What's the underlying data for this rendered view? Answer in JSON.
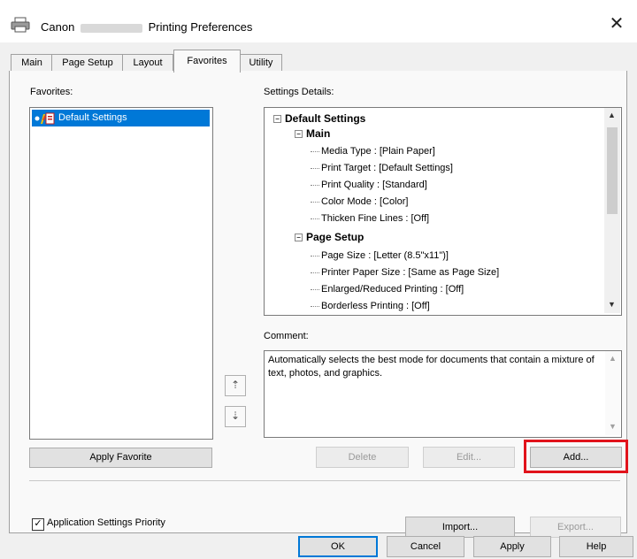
{
  "window": {
    "title_prefix": "Canon",
    "title_suffix": "Printing Preferences",
    "close_glyph": "✕"
  },
  "tabs": [
    {
      "label": "Main"
    },
    {
      "label": "Page Setup"
    },
    {
      "label": "Layout"
    },
    {
      "label": "Favorites"
    },
    {
      "label": "Utility"
    }
  ],
  "favorites": {
    "label": "Favorites:",
    "items": [
      "Default Settings"
    ],
    "apply_button": "Apply Favorite",
    "move_up_glyph": "⇡",
    "move_down_glyph": "⇣"
  },
  "details": {
    "label": "Settings Details:",
    "root": "Default Settings",
    "groups": [
      {
        "name": "Main",
        "items": [
          "Media Type : [Plain Paper]",
          "Print Target : [Default Settings]",
          "Print Quality : [Standard]",
          "Color Mode : [Color]",
          "Thicken Fine Lines : [Off]"
        ]
      },
      {
        "name": "Page Setup",
        "items": [
          "Page Size : [Letter (8.5\"x11\")]",
          "Printer Paper Size : [Same as Page Size]",
          "Enlarged/Reduced Printing : [Off]",
          "Borderless Printing : [Off]"
        ]
      }
    ]
  },
  "comment": {
    "label": "Comment:",
    "text": "Automatically selects the best mode for documents that contain a mixture of text, photos, and graphics."
  },
  "actions": {
    "delete": "Delete",
    "edit": "Edit...",
    "add": "Add..."
  },
  "bottom": {
    "app_priority_label": "Application Settings Priority",
    "app_priority_checked": true,
    "import": "Import...",
    "export": "Export..."
  },
  "dialog": {
    "ok": "OK",
    "cancel": "Cancel",
    "apply": "Apply",
    "help": "Help"
  },
  "colors": {
    "selection": "#0078d7",
    "highlight_border": "#e1131b"
  }
}
